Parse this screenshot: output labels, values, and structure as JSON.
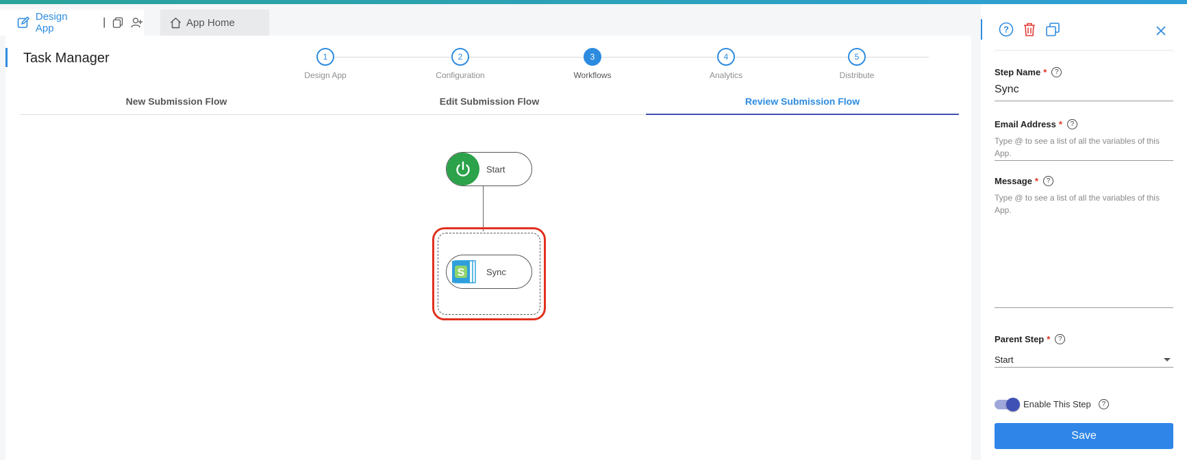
{
  "top_tabs": {
    "design_app": "Design App",
    "separator": "|",
    "app_home": "App Home"
  },
  "app": {
    "title": "Task Manager"
  },
  "stepper": {
    "steps": [
      {
        "number": "1",
        "label": "Design App",
        "active": false
      },
      {
        "number": "2",
        "label": "Configuration",
        "active": false
      },
      {
        "number": "3",
        "label": "Workflows",
        "active": true
      },
      {
        "number": "4",
        "label": "Analytics",
        "active": false
      },
      {
        "number": "5",
        "label": "Distribute",
        "active": false
      }
    ]
  },
  "flow_tabs": [
    {
      "label": "New Submission Flow",
      "active": false
    },
    {
      "label": "Edit Submission Flow",
      "active": false
    },
    {
      "label": "Review Submission Flow",
      "active": true
    }
  ],
  "canvas": {
    "start_node": {
      "label": "Start",
      "icon": "power-icon"
    },
    "sync_node": {
      "label": "Sync",
      "icon": "sync-app-icon"
    }
  },
  "panel": {
    "tools": [
      "help-icon",
      "trash-icon",
      "copy-icon"
    ],
    "close_icon": "close-icon",
    "step_name": {
      "label": "Step Name",
      "required": "*",
      "value": "Sync"
    },
    "email": {
      "label": "Email Address",
      "required": "*",
      "placeholder": "Type @ to see a list of all the variables of this App."
    },
    "message": {
      "label": "Message",
      "required": "*",
      "placeholder": "Type @ to see a list of all the variables of this App."
    },
    "parent_step": {
      "label": "Parent Step",
      "required": "*",
      "value": "Start"
    },
    "enable": {
      "label": "Enable This Step",
      "enabled": true
    },
    "save_label": "Save",
    "help_glyph": "?"
  },
  "colors": {
    "accent": "#2d8be0",
    "start_green": "#2ca24a",
    "selection_red": "#e0301e",
    "toggle": "#3f51b5"
  }
}
